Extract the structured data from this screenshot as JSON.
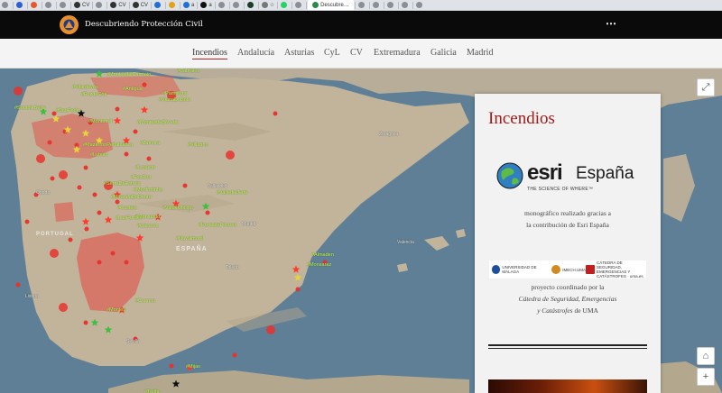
{
  "browser": {
    "tabs": [
      {
        "icon": "chrome-icon",
        "label": "",
        "color": "#8a8f96"
      },
      {
        "icon": "p-icon",
        "label": "",
        "color": "#2f5fd1"
      },
      {
        "icon": "sc-icon",
        "label": "",
        "color": "#e35a2b"
      },
      {
        "icon": "chrome-icon",
        "label": "",
        "color": "#8a8f96"
      },
      {
        "icon": "chrome-icon",
        "label": "",
        "color": "#8a8f96"
      },
      {
        "icon": "cv-icon",
        "label": "CV",
        "color": "#333333"
      },
      {
        "icon": "chrome-icon",
        "label": "",
        "color": "#8a8f96"
      },
      {
        "icon": "cv-icon",
        "label": "CV",
        "color": "#333333"
      },
      {
        "icon": "cv-icon",
        "label": "CV",
        "color": "#333333"
      },
      {
        "icon": "lock-icon",
        "label": "",
        "color": "#1f6fd6"
      },
      {
        "icon": "doc-icon",
        "label": "",
        "color": "#e2a21c"
      },
      {
        "icon": "a-icon",
        "label": "a",
        "color": "#1f6fd6"
      },
      {
        "icon": "amazon-icon",
        "label": "a",
        "color": "#111111"
      },
      {
        "icon": "chrome-icon",
        "label": "",
        "color": "#8a8f96"
      },
      {
        "icon": "chrome-icon",
        "label": "",
        "color": "#8a8f96"
      },
      {
        "icon": "oe-icon",
        "label": "",
        "color": "#1c3d2a"
      },
      {
        "icon": "star-icon",
        "label": "☆",
        "color": "#777777"
      },
      {
        "icon": "whatsapp-icon",
        "label": "",
        "color": "#25d366"
      },
      {
        "icon": "chrome-icon",
        "label": "",
        "color": "#8a8f96"
      },
      {
        "icon": "esri-tab-icon",
        "label": "Descubre…",
        "color": "#2a8a4a"
      },
      {
        "icon": "chrome-icon",
        "label": "",
        "color": "#8a8f96"
      },
      {
        "icon": "chrome-icon",
        "label": "",
        "color": "#8a8f96"
      },
      {
        "icon": "chrome-icon",
        "label": "",
        "color": "#8a8f96"
      },
      {
        "icon": "chrome-icon",
        "label": "",
        "color": "#8a8f96"
      },
      {
        "icon": "chrome-icon",
        "label": "",
        "color": "#8a8f96"
      }
    ]
  },
  "header": {
    "title": "Descubriendo Protección Civil",
    "logo_color": "#e8902a",
    "menu_icon": "⋯"
  },
  "nav": {
    "items": [
      {
        "label": "Incendios",
        "active": true
      },
      {
        "label": "Andalucía",
        "active": false
      },
      {
        "label": "Asturias",
        "active": false
      },
      {
        "label": "CyL",
        "active": false
      },
      {
        "label": "CV",
        "active": false
      },
      {
        "label": "Extremadura",
        "active": false
      },
      {
        "label": "Galicia",
        "active": false
      },
      {
        "label": "Madrid",
        "active": false
      }
    ],
    "accent": "#b22222"
  },
  "map": {
    "country_labels": {
      "spain": "ESPAÑA",
      "portugal": "PORTUGAL"
    },
    "fire_labels": [
      "#Cabrales",
      "#MontesdelCarmaio",
      "#Vilardevós",
      "#Antigua",
      "#FozdeCoa",
      "#Soutolt.Beira",
      "#SaoPedro",
      "#Pamplona",
      "#Monterrei",
      "#MontesdeBóveda",
      "#VianaDoBolo",
      "#MazarrónPeñablanca",
      "#Zamora",
      "#Villarino",
      "#Lubián",
      "#Losacio",
      "#FozCoa",
      "#MirandaDoDouro",
      "#SerraDaEstrela",
      "#Monfortinho",
      "#Castelo",
      "#Monsanto",
      "#Cáceres",
      "#LasHurdes",
      "#ValdeObispo",
      "#ValledelJerte",
      "#Navalmoral",
      "#PortaldePinares",
      "#Monsaraz",
      "#Almaden",
      "#Cuenca",
      "#Montes",
      "#Mijas",
      "#Tarifa"
    ],
    "place_labels": [
      "Valladolid",
      "Madrid",
      "Toledo",
      "Sevilla",
      "Lisboa",
      "Oporto",
      "Zaragoza",
      "Valencia",
      "Barcelona"
    ],
    "colors": {
      "sea": "#5f7f97",
      "land": "#c2b49a",
      "burned": "#e0584e",
      "fire_dot": "#e8322c",
      "star_red": "#ff3a2e",
      "star_yellow": "#e8d23a",
      "star_green": "#3fbf3f",
      "label": "#c8ff40"
    },
    "controls": {
      "expand_icon": "⤢",
      "home_icon": "⌂",
      "zoom_in_icon": "+"
    }
  },
  "panel": {
    "title": "Incendios",
    "esri": {
      "word": "esri",
      "country": "España",
      "tagline": "THE SCIENCE OF WHERE™"
    },
    "credit_line1": "monográfico realizado gracias a",
    "credit_line2": "la contribución de Esri España",
    "partners": [
      {
        "label": "UNIVERSIDAD DE MÁLAGA",
        "color": "#1f4f9c"
      },
      {
        "label": "IMECH.UMA",
        "color": "#d08a1f"
      },
      {
        "label": "CÁTEDRA DE SEGURIDAD, EMERGENCIAS Y CATÁSTROFES · uma.es",
        "color": "#c41e1e"
      }
    ],
    "project_line1": "proyecto coordinado por la",
    "project_line2": "Cátedra de Seguridad, Emergencias",
    "project_line3a": "y Catástrofes",
    "project_line3b": " de UMA"
  }
}
